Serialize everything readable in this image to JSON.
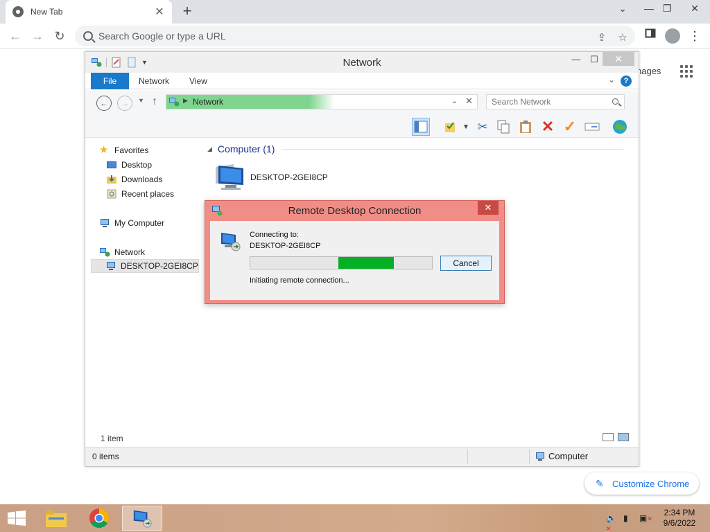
{
  "chrome": {
    "tab_title": "New Tab",
    "tab_close": "✕",
    "new_tab": "+",
    "window_controls": [
      "⌄",
      "—",
      "❐",
      "✕"
    ],
    "omnibox_placeholder": "Search Google or type a URL",
    "ntp_images_text": "nages",
    "customize_label": "Customize Chrome"
  },
  "explorer": {
    "title": "Network",
    "ribbon_tabs": [
      "File",
      "Network",
      "View"
    ],
    "address_path": "Network",
    "search_placeholder": "Search Network",
    "nav": {
      "favorites": "Favorites",
      "desktop": "Desktop",
      "downloads": "Downloads",
      "recent_places": "Recent places",
      "my_computer": "My Computer",
      "network": "Network",
      "network_child": "DESKTOP-2GEI8CP"
    },
    "group_header": "Computer (1)",
    "computer_name": "DESKTOP-2GEI8CP",
    "item_count": "1 item",
    "status_left": "0 items",
    "status_right": "Computer"
  },
  "rdc": {
    "title": "Remote Desktop Connection",
    "close": "✕",
    "connecting_label": "Connecting to:",
    "target": "DESKTOP-2GEI8CP",
    "cancel_label": "Cancel",
    "status_text": "Initiating remote connection...",
    "progress_indicator_fraction": 0.3
  },
  "taskbar": {
    "time": "2:34 PM",
    "date": "9/6/2022"
  },
  "colors": {
    "accent": "#1979ca",
    "rdc_frame": "#f08d86",
    "progress_green": "#06b025"
  }
}
